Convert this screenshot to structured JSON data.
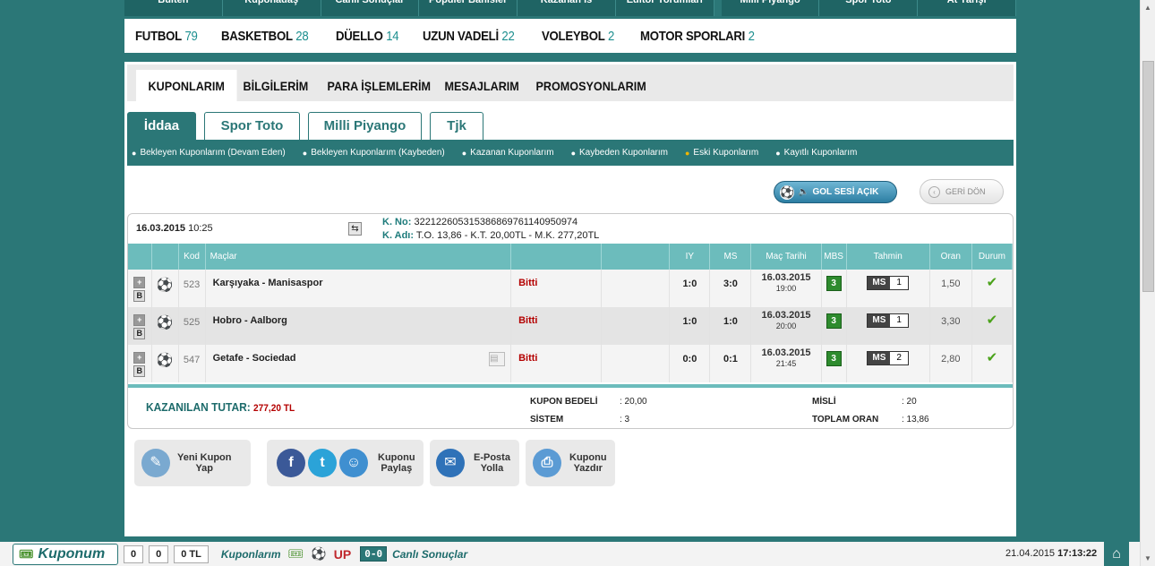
{
  "topnav": {
    "items": [
      "Bülten",
      "Kuponadaş",
      "Canlı Sonuçlar",
      "Popüler Bahisler",
      "Kazanan İs",
      "Editör Yorumları",
      "Milli Piyango",
      "Spor Toto",
      "At Yarışı"
    ]
  },
  "sports": [
    {
      "name": "FUTBOL",
      "count": "79"
    },
    {
      "name": "BASKETBOL",
      "count": "28"
    },
    {
      "name": "DÜELLO",
      "count": "14"
    },
    {
      "name": "UZUN VADELİ",
      "count": "22"
    },
    {
      "name": "VOLEYBOL",
      "count": "2"
    },
    {
      "name": "MOTOR SPORLARI",
      "count": "2"
    }
  ],
  "account_tabs": [
    "KUPONLARIM",
    "BİLGİLERİM",
    "PARA İŞLEMLERİM",
    "MESAJLARIM",
    "PROMOSYONLARIM"
  ],
  "game_tabs": [
    "İddaa",
    "Spor Toto",
    "Milli Piyango",
    "Tjk"
  ],
  "subnav": [
    "Bekleyen Kuponlarım (Devam Eden)",
    "Bekleyen Kuponlarım (Kaybeden)",
    "Kazanan Kuponlarım",
    "Kaybeden Kuponlarım",
    "Eski Kuponlarım",
    "Kayıtlı Kuponlarım"
  ],
  "buttons": {
    "gol_sesi": "GOL SESİ AÇIK",
    "geri_don": "GERİ DÖN"
  },
  "coupon": {
    "date": "16.03.2015",
    "time": "10:25",
    "kno_label": "K. No:",
    "kno": "322122605315386869761140950974",
    "kadi_label": "K. Adı:",
    "kadi": "T.O. 13,86 - K.T. 20,00TL - M.K. 277,20TL"
  },
  "table": {
    "headers": {
      "kod": "Kod",
      "maclar": "Maçlar",
      "iy": "IY",
      "ms": "MS",
      "tarih": "Maç Tarihi",
      "mbs": "MBS",
      "tahmin": "Tahmin",
      "oran": "Oran",
      "durum": "Durum"
    },
    "rows": [
      {
        "kod": "523",
        "mac": "Karşıyaka - Manisaspor",
        "status": "Bitti",
        "iy": "1:0",
        "ms": "3:0",
        "date": "16.03.2015",
        "time": "19:00",
        "mbs": "3",
        "tahmin_type": "MS",
        "tahmin_val": "1",
        "oran": "1,50",
        "b": "B"
      },
      {
        "kod": "525",
        "mac": "Hobro - Aalborg",
        "status": "Bitti",
        "iy": "1:0",
        "ms": "1:0",
        "date": "16.03.2015",
        "time": "20:00",
        "mbs": "3",
        "tahmin_type": "MS",
        "tahmin_val": "1",
        "oran": "3,30",
        "b": "B"
      },
      {
        "kod": "547",
        "mac": "Getafe - Sociedad",
        "status": "Bitti",
        "iy": "0:0",
        "ms": "0:1",
        "date": "16.03.2015",
        "time": "21:45",
        "mbs": "3",
        "tahmin_type": "MS",
        "tahmin_val": "2",
        "oran": "2,80",
        "b": "B"
      }
    ]
  },
  "footer": {
    "kazanilan_label": "KAZANILAN TUTAR:",
    "kazanilan": "277,20 TL",
    "kupon_bedeli_label": "KUPON BEDELİ",
    "kupon_bedeli": ": 20,00",
    "sistem_label": "SİSTEM",
    "sistem": ": 3",
    "misli_label": "MİSLİ",
    "misli": ": 20",
    "toplam_oran_label": "TOPLAM ORAN",
    "toplam_oran": ": 13,86"
  },
  "actions": {
    "yeni_kupon_1": "Yeni Kupon",
    "yeni_kupon_2": "Yap",
    "paylas_1": "Kuponu",
    "paylas_2": "Paylaş",
    "eposta_1": "E-Posta",
    "eposta_2": "Yolla",
    "yazdir_1": "Kuponu",
    "yazdir_2": "Yazdır"
  },
  "bottombar": {
    "logo": "Kuponum",
    "count1": "0",
    "count2": "0",
    "money": "0 TL",
    "kuponlarim": "Kuponlarım",
    "canli": "Canlı Sonuçlar",
    "live_box": "0-0",
    "date": "21.04.2015",
    "time": "17:13:22"
  },
  "colors": {
    "teal": "#2b7777",
    "header_teal": "#6cbcbc",
    "status_red": "#b40000",
    "mbs_green": "#2e8b2e"
  }
}
